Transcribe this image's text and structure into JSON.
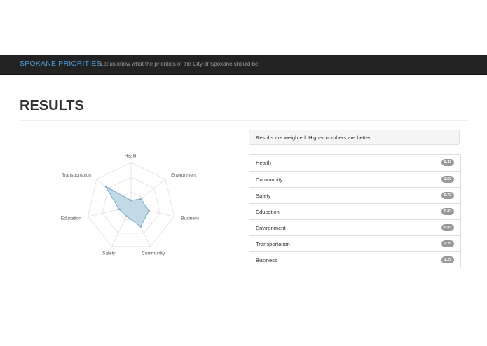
{
  "navbar": {
    "brand": "SPOKANE PRIORITIES",
    "tagline": "Let us know what the priorities of the City of Spokane should be."
  },
  "page": {
    "title": "RESULTS"
  },
  "note": {
    "text": "Results are weighted. Higher numbers are better."
  },
  "results": [
    {
      "label": "Health",
      "score": "0.43"
    },
    {
      "label": "Community",
      "score": "1.50"
    },
    {
      "label": "Safety",
      "score": "0.72"
    },
    {
      "label": "Education",
      "score": "0.83"
    },
    {
      "label": "Environment",
      "score": "0.83"
    },
    {
      "label": "Transportation",
      "score": "2.20"
    },
    {
      "label": "Business",
      "score": "1.25"
    }
  ],
  "colors": {
    "navbar": "#222222",
    "brand": "#4b9cd8",
    "badge": "#999999",
    "radar_fill": "#b8d4e3",
    "radar_stroke": "#7ba7c2"
  },
  "chart_data": {
    "type": "radar",
    "axes": [
      "Health",
      "Environment",
      "Business",
      "Community",
      "Safety",
      "Education",
      "Transportation"
    ],
    "values": [
      0.43,
      0.83,
      1.25,
      1.5,
      0.72,
      0.83,
      2.2
    ],
    "range": [
      0,
      3
    ],
    "grid_levels": 3,
    "grid": true
  }
}
